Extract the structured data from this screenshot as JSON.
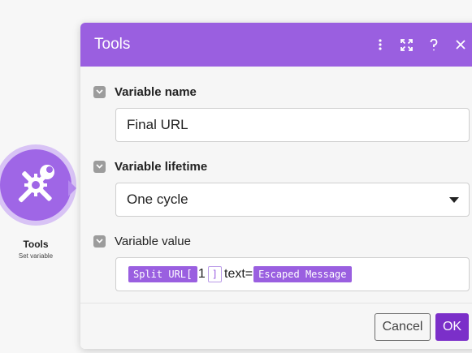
{
  "module": {
    "title": "Tools",
    "subtitle": "Set variable",
    "icon": "tools-icon"
  },
  "dialog": {
    "title": "Tools",
    "header_icons": [
      "more-vertical-icon",
      "expand-icon",
      "help-icon",
      "close-icon"
    ],
    "fields": {
      "variable_name": {
        "label": "Variable name",
        "value": "Final URL"
      },
      "variable_lifetime": {
        "label": "Variable lifetime",
        "value": "One cycle"
      },
      "variable_value": {
        "label": "Variable value",
        "tokens": {
          "pill1": "Split URL",
          "bracket_open": "[",
          "index": "1",
          "bracket_close": "]",
          "text": "text=",
          "pill2": "Escaped Message"
        }
      }
    },
    "buttons": {
      "cancel": "Cancel",
      "ok": "OK"
    }
  },
  "colors": {
    "accent": "#9a5fe0",
    "ok_button": "#7b2fc9",
    "checkbox": "#9c9c9c"
  }
}
